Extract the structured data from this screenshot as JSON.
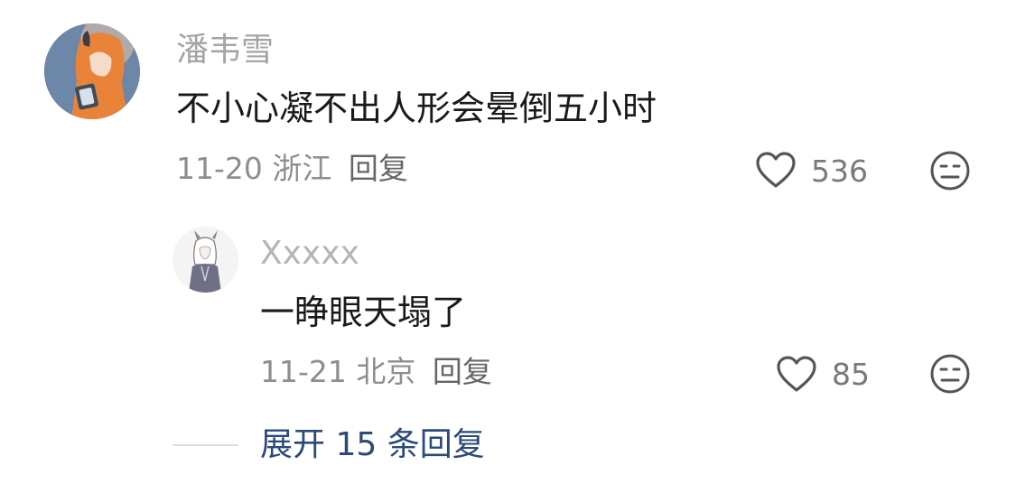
{
  "comment": {
    "username": "潘韦雪",
    "text": "不小心凝不出人形会晕倒五小时",
    "date": "11-20",
    "location": "浙江",
    "reply_label": "回复",
    "likes": "536"
  },
  "reply": {
    "username": "Xxxxx",
    "text": "一睁眼天塌了",
    "date": "11-21",
    "location": "北京",
    "reply_label": "回复",
    "likes": "85"
  },
  "expand": {
    "label": "展开 15 条回复"
  },
  "colors": {
    "username": "#a4a4a4",
    "comment_text": "#1a1a1a",
    "meta": "#8e8e8e",
    "expand_link": "#2c4a78",
    "icon": "#555555"
  },
  "icons": {
    "like": "heart-outline-icon",
    "dislike": "neutral-face-icon"
  }
}
